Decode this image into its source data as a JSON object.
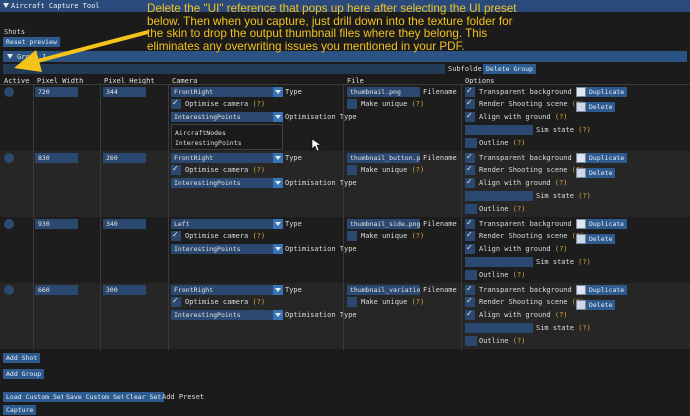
{
  "window": {
    "title": "Aircraft Capture Tool"
  },
  "shots_label": "Shots",
  "reset_preview": "Reset preview",
  "group": {
    "label": "Group 1"
  },
  "subfolder_label": "Subfolder",
  "delete_group": "Delete Group",
  "headers": {
    "active": "Active",
    "width": "Pixel Width",
    "height": "Pixel Height",
    "camera": "Camera",
    "file": "File",
    "options": "Options"
  },
  "labels": {
    "type": "Type",
    "opt_camera": "Optimise camera",
    "opt_type": "Optimisation Type",
    "filename": "Filename",
    "make_unique": "Make unique",
    "transparent_bg": "Transparent background",
    "render_scene": "Render Shooting scene",
    "align_ground": "Align with ground",
    "sim_state": "Sim state",
    "outline": "Outline",
    "help": "(?)",
    "duplicate": "Duplicate",
    "delete": "Delete"
  },
  "rows": [
    {
      "width": "720",
      "height": "344",
      "camera": "FrontRight",
      "opt_type": "InterestingPoints",
      "filename": "thumbnail.png"
    },
    {
      "width": "830",
      "height": "260",
      "camera": "FrontRight",
      "opt_type": "InterestingPoints",
      "filename": "thumbnail_button.png"
    },
    {
      "width": "930",
      "height": "340",
      "camera": "Left",
      "opt_type": "InterestingPoints",
      "filename": "thumbnail_side.png"
    },
    {
      "width": "660",
      "height": "300",
      "camera": "FrontRight",
      "opt_type": "InterestingPoints",
      "filename": "thumbnail_variation.p"
    }
  ],
  "dropdown_options": [
    "AircraftNodes",
    "InterestingPoints"
  ],
  "footer": {
    "add_shot": "Add Shot",
    "add_group": "Add Group",
    "load_set": "Load Custom Set",
    "save_set": "Save Custom Set",
    "clear_set": "Clear Set",
    "add_preset": "Add Preset",
    "capture": "Capture"
  },
  "annotation": "Delete the \"UI\" reference that pops up here after selecting the UI preset below. Then when you capture, just drill down into the texture folder for the skin to drop the output thumbnail files where they belong. This eliminates any overwriting issues you mentioned in your PDF.",
  "colors": {
    "accent": "#2d5b8f",
    "note": "#f3c21b",
    "help": "#e0a83a"
  }
}
